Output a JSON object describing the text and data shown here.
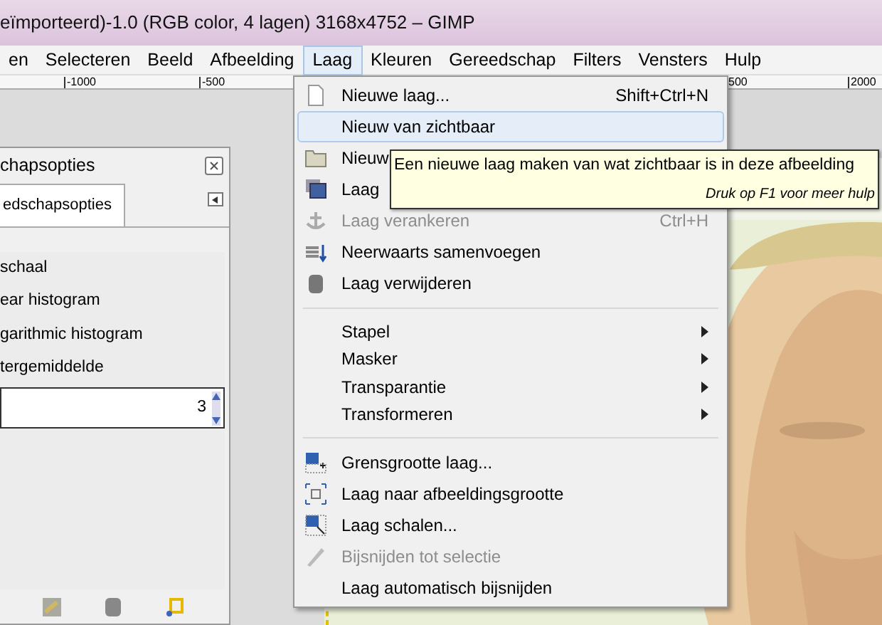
{
  "window": {
    "title": "eïmporteerd)-1.0 (RGB color, 4 lagen) 3168x4752 – GIMP"
  },
  "menubar": [
    {
      "label": "en",
      "selected": false
    },
    {
      "label": "Selecteren",
      "selected": false
    },
    {
      "label": "Beeld",
      "selected": false
    },
    {
      "label": "Afbeelding",
      "selected": false
    },
    {
      "label": "Laag",
      "selected": true
    },
    {
      "label": "Kleuren",
      "selected": false
    },
    {
      "label": "Gereedschap",
      "selected": false
    },
    {
      "label": "Filters",
      "selected": false
    },
    {
      "label": "Vensters",
      "selected": false
    },
    {
      "label": "Hulp",
      "selected": false
    }
  ],
  "ruler": {
    "left_labels": [
      "-1000",
      "-500"
    ],
    "right_labels": [
      "500",
      "2000"
    ]
  },
  "dock": {
    "title": "chapsopties",
    "tab": "edschapsopties",
    "options": [
      "schaal",
      "ear histogram",
      "garithmic histogram",
      "tergemiddelde"
    ],
    "spin_value": "3"
  },
  "menu": {
    "items": [
      {
        "kind": "item",
        "label": "Nieuwe laag...",
        "shortcut": "Shift+Ctrl+N",
        "disabled": false,
        "selected": false
      },
      {
        "kind": "item",
        "label": "Nieuw van zichtbaar",
        "disabled": false,
        "selected": true
      },
      {
        "kind": "item",
        "label": "Nieuw",
        "disabled": false,
        "selected": false
      },
      {
        "kind": "item",
        "label": "Laag",
        "disabled": false,
        "selected": false
      },
      {
        "kind": "item",
        "label": "Laag verankeren",
        "shortcut": "Ctrl+H",
        "disabled": true,
        "selected": false
      },
      {
        "kind": "item",
        "label": "Neerwaarts samenvoegen",
        "disabled": false,
        "selected": false
      },
      {
        "kind": "item",
        "label": "Laag verwijderen",
        "disabled": false,
        "selected": false
      },
      {
        "kind": "separator"
      },
      {
        "kind": "submenu",
        "label": "Stapel",
        "disabled": false,
        "selected": false
      },
      {
        "kind": "submenu",
        "label": "Masker",
        "disabled": false,
        "selected": false
      },
      {
        "kind": "submenu",
        "label": "Transparantie",
        "disabled": false,
        "selected": false
      },
      {
        "kind": "submenu",
        "label": "Transformeren",
        "disabled": false,
        "selected": false
      },
      {
        "kind": "separator"
      },
      {
        "kind": "item",
        "label": "Grensgrootte laag...",
        "disabled": false,
        "selected": false
      },
      {
        "kind": "item",
        "label": "Laag naar afbeeldingsgrootte",
        "disabled": false,
        "selected": false
      },
      {
        "kind": "item",
        "label": "Laag schalen...",
        "disabled": false,
        "selected": false
      },
      {
        "kind": "item",
        "label": "Bijsnijden tot selectie",
        "disabled": true,
        "selected": false
      },
      {
        "kind": "item",
        "label": "Laag automatisch bijsnijden",
        "disabled": false,
        "selected": false
      }
    ]
  },
  "tooltip": {
    "text": "Een nieuwe laag maken van wat zichtbaar is in deze afbeelding",
    "hint": "Druk op F1 voor meer hulp"
  }
}
